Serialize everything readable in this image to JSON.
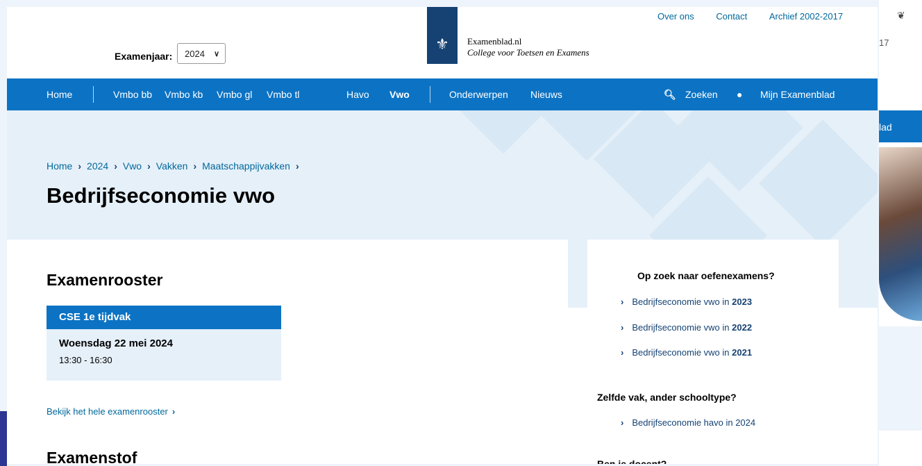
{
  "background": {
    "right_text": "17",
    "right_bar_text": "lad"
  },
  "header": {
    "top_links": [
      "Over ons",
      "Contact",
      "Archief 2002-2017"
    ],
    "year_label": "Examenjaar:",
    "year_value": "2024",
    "logo_title": "Examenblad.nl",
    "logo_subtitle": "College voor Toetsen en Examens"
  },
  "nav": {
    "items": [
      "Home",
      "Vmbo bb",
      "Vmbo kb",
      "Vmbo gl",
      "Vmbo tl",
      "Havo",
      "Vwo",
      "Onderwerpen",
      "Nieuws"
    ],
    "search": "Zoeken",
    "account": "Mijn Examenblad"
  },
  "breadcrumb": [
    "Home",
    "2024",
    "Vwo",
    "Vakken",
    "Maatschappijvakken"
  ],
  "page_title": "Bedrijfseconomie vwo",
  "schedule": {
    "heading": "Examenrooster",
    "period": "CSE 1e tijdvak",
    "date": "Woensdag 22 mei 2024",
    "time": "13:30 - 16:30",
    "link": "Bekijk het hele examenrooster"
  },
  "examenstof_heading": "Examenstof",
  "sidebar": {
    "practice_heading": "Op zoek naar oefenexamens?",
    "practice_prefix": "Bedrijfseconomie vwo in",
    "practice_years": [
      "2023",
      "2022",
      "2021"
    ],
    "other_heading": "Zelfde vak, ander schooltype?",
    "other_link": "Bedrijfseconomie havo in 2024",
    "teacher_heading": "Ben je docent?"
  },
  "colors": {
    "brand_blue": "#0c73c4",
    "dark_blue": "#154273",
    "hero_bg": "#e6f0f9"
  }
}
